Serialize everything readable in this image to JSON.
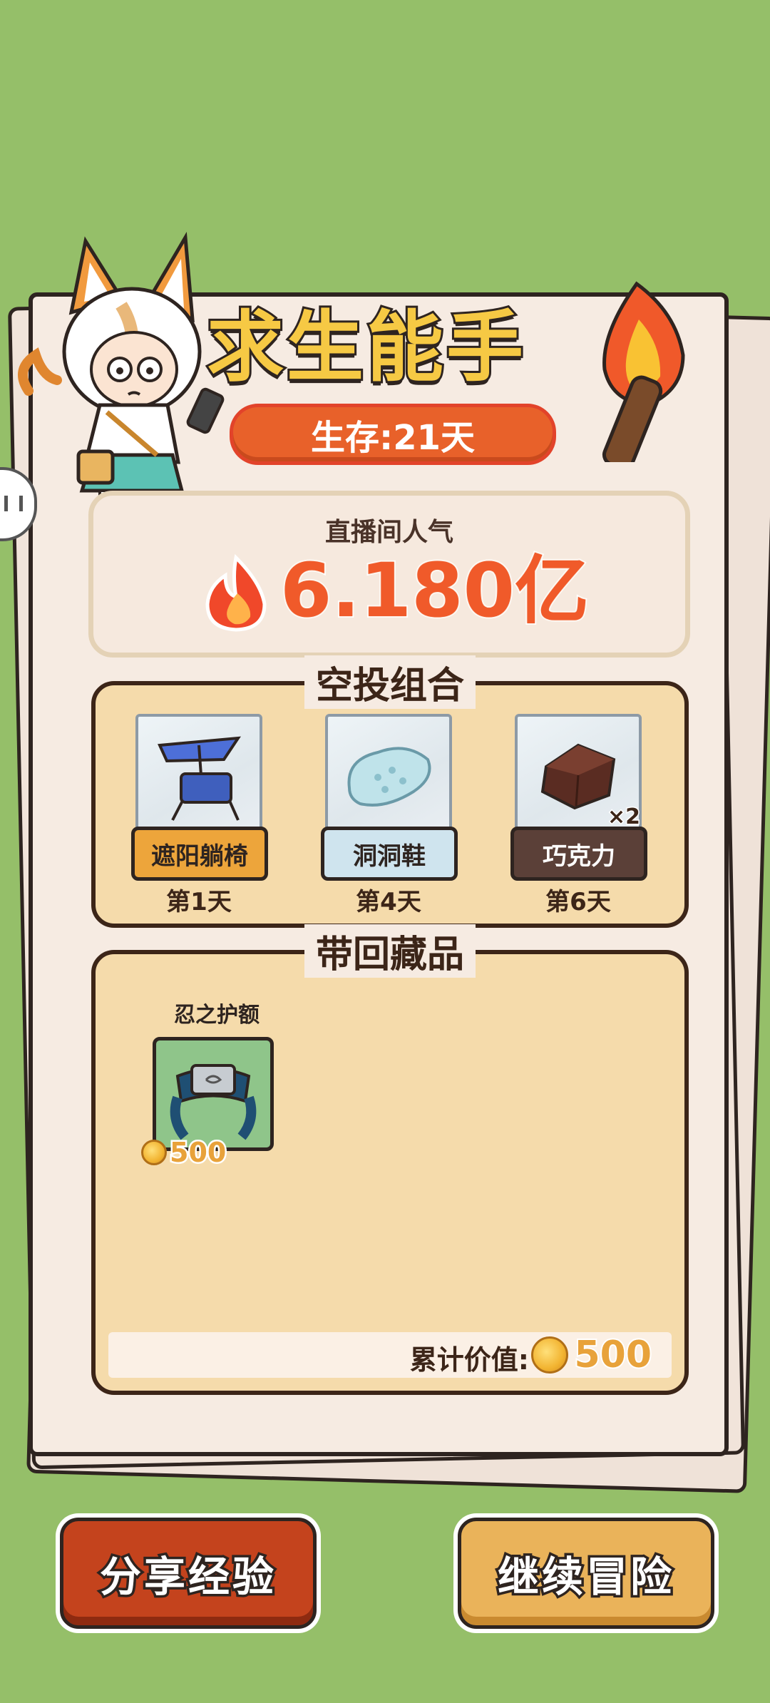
{
  "header": {
    "title": "求生能手",
    "survival_days": "生存:21天"
  },
  "popularity": {
    "label": "直播间人气",
    "value": "6.180亿"
  },
  "airdrop": {
    "title": "空投组合",
    "items": [
      {
        "name": "遮阳躺椅",
        "day": "第1天",
        "icon": "sun-lounger-icon"
      },
      {
        "name": "洞洞鞋",
        "day": "第4天",
        "icon": "clog-icon"
      },
      {
        "name": "巧克力",
        "day": "第6天",
        "icon": "chocolate-icon",
        "quantity": "×2"
      }
    ]
  },
  "collection": {
    "title": "带回藏品",
    "items": [
      {
        "name": "忍之护额",
        "price": "500",
        "icon": "ninja-headband-icon"
      }
    ],
    "total_label": "累计价值:",
    "total_value": "500"
  },
  "buttons": {
    "share": "分享经验",
    "continue": "继续冒险"
  },
  "colors": {
    "background": "#95bf69",
    "accent_orange": "#e8612a",
    "gold": "#e8a23a"
  }
}
